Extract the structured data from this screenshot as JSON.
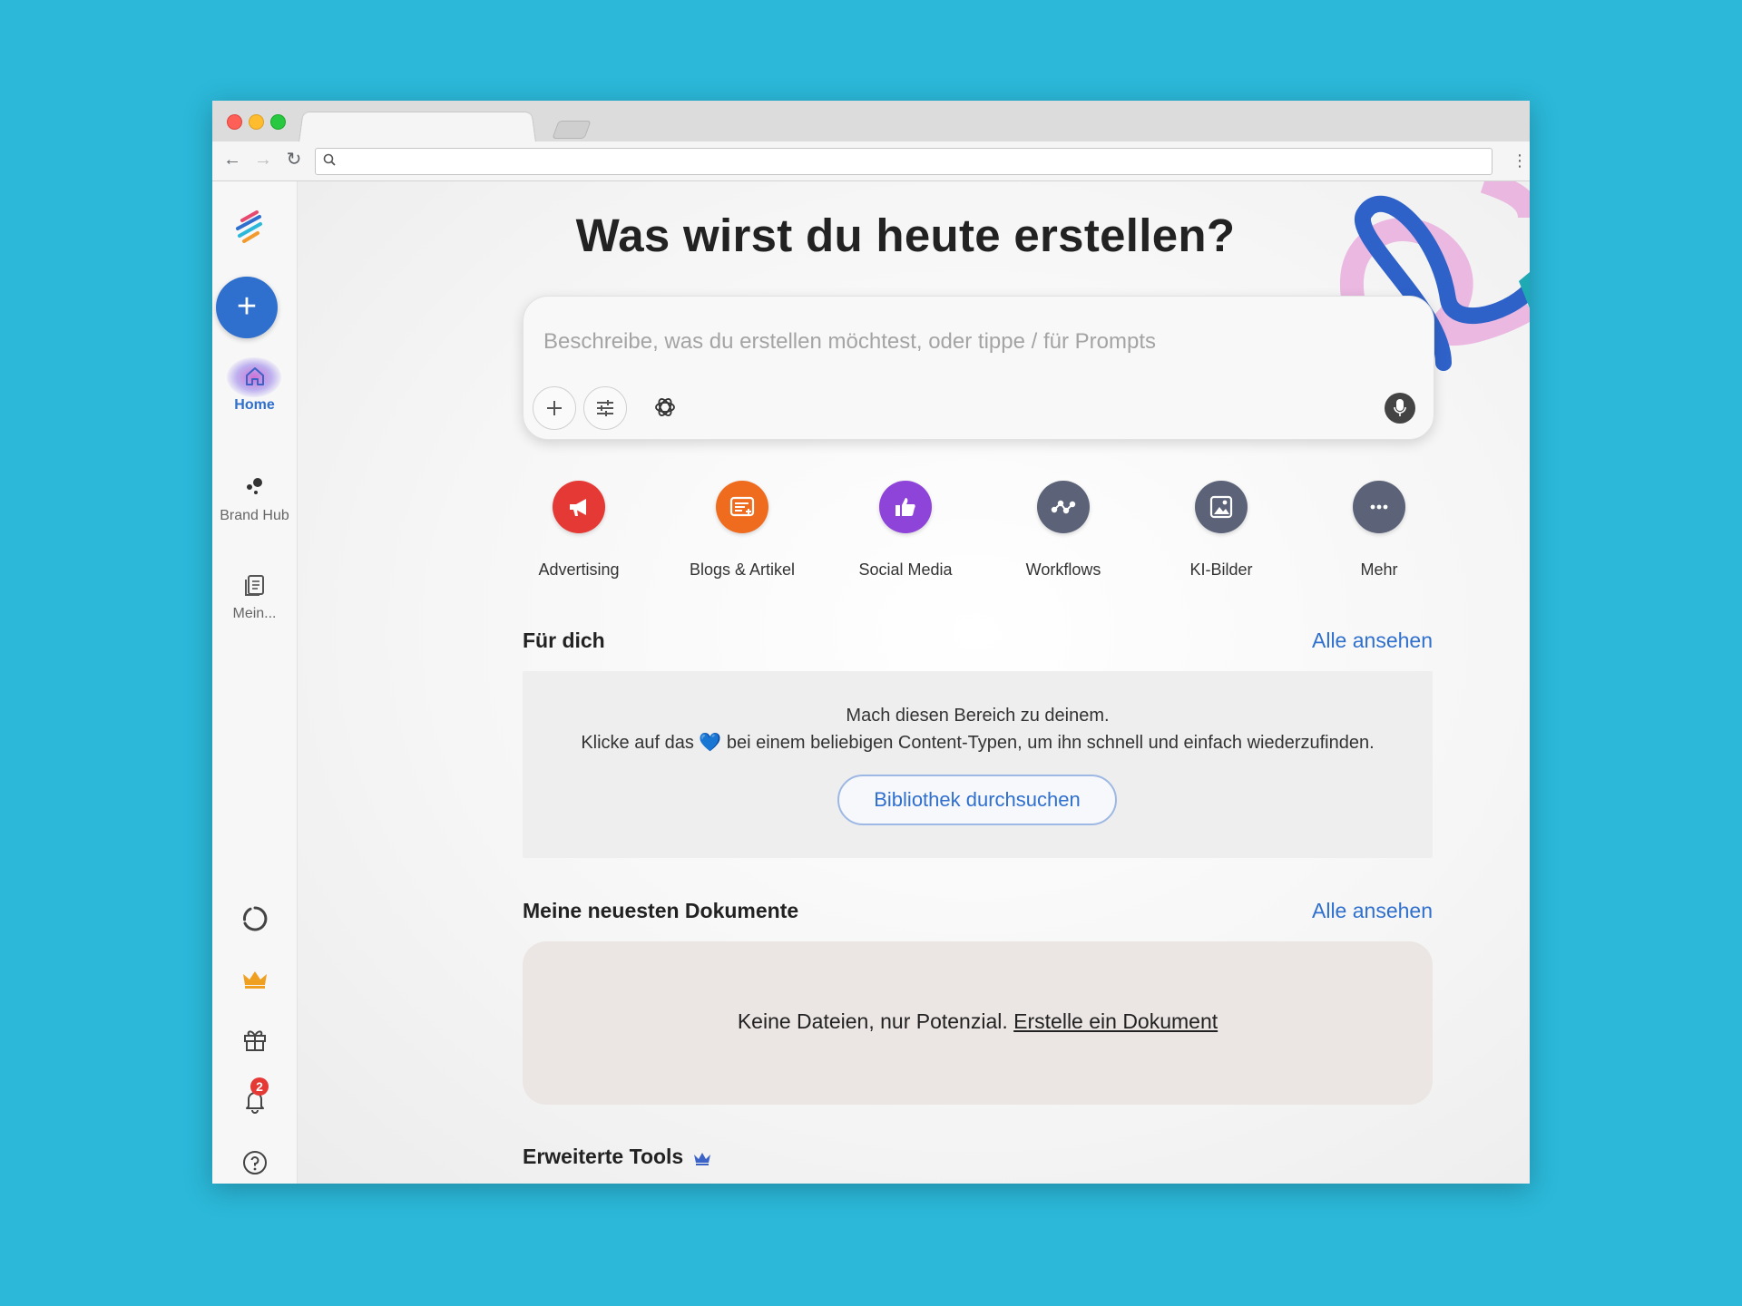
{
  "sidebar": {
    "new_label": "+",
    "items": [
      {
        "label": "Home",
        "icon": "home-icon"
      },
      {
        "label": "Brand Hub",
        "icon": "brand-hub-icon"
      },
      {
        "label": "Mein...",
        "icon": "documents-icon"
      }
    ],
    "notification_count": "2"
  },
  "main": {
    "headline": "Was wirst du heute erstellen?",
    "prompt_placeholder": "Beschreibe, was du erstellen möchtest, oder tippe / für Prompts",
    "categories": [
      {
        "label": "Advertising",
        "color": "#e53935",
        "icon": "megaphone-icon"
      },
      {
        "label": "Blogs & Artikel",
        "color": "#ef6c1f",
        "icon": "article-icon"
      },
      {
        "label": "Social Media",
        "color": "#8e44d9",
        "icon": "thumbs-up-icon"
      },
      {
        "label": "Workflows",
        "color": "#5c6378",
        "icon": "workflow-icon"
      },
      {
        "label": "KI-Bilder",
        "color": "#5c6378",
        "icon": "image-icon"
      },
      {
        "label": "Mehr",
        "color": "#5c6378",
        "icon": "more-icon"
      }
    ],
    "for_you": {
      "title": "Für dich",
      "see_all": "Alle ansehen",
      "line1": "Mach diesen Bereich zu deinem.",
      "line2_before": "Klicke auf das ",
      "heart": "💙",
      "line2_after": " bei einem beliebigen Content-Typen, um ihn schnell und einfach wiederzufinden.",
      "button": "Bibliothek durchsuchen"
    },
    "recent_docs": {
      "title": "Meine neuesten Dokumente",
      "see_all": "Alle ansehen",
      "text": "Keine Dateien, nur Potenzial. ",
      "link": "Erstelle ein Dokument"
    },
    "advanced_tools": {
      "title": "Erweiterte Tools"
    }
  },
  "colors": {
    "accent": "#2f6fce",
    "background": "#2bb8d9"
  }
}
